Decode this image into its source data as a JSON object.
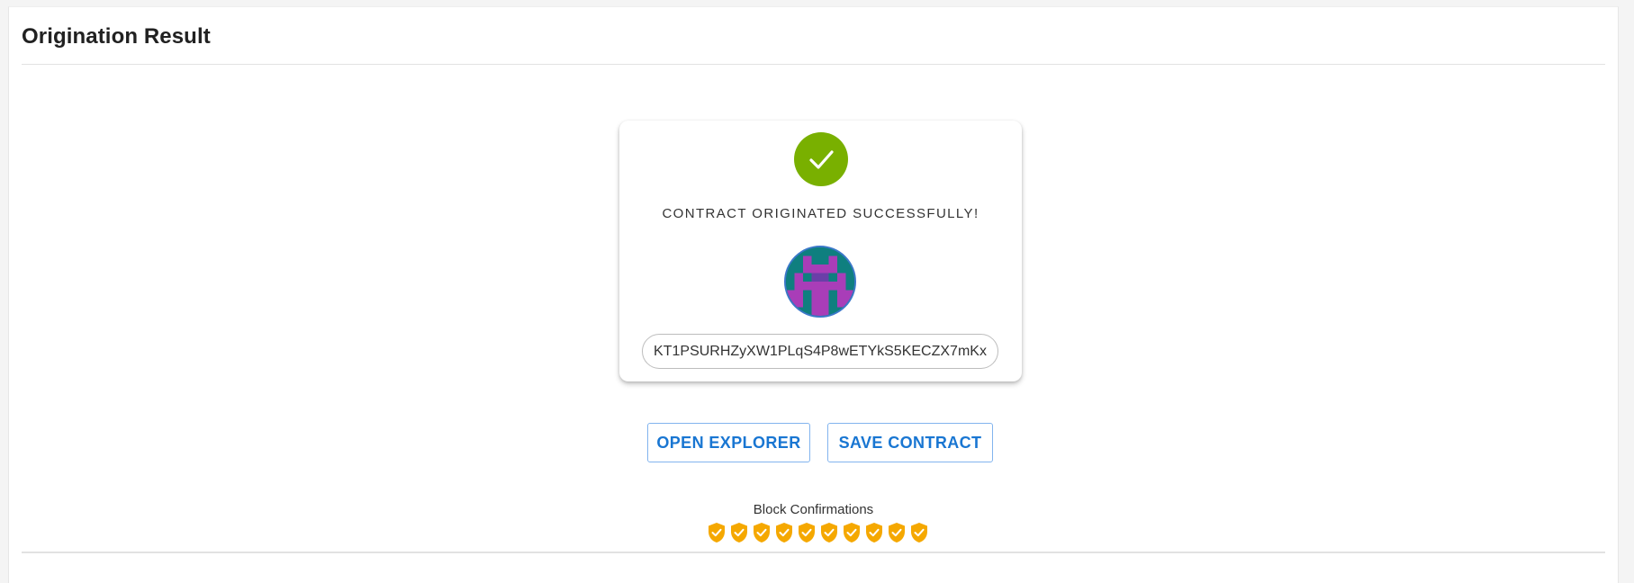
{
  "header": {
    "title": "Origination Result"
  },
  "result_card": {
    "icon": "check-circle-icon",
    "success_message": "CONTRACT ORIGINATED SUCCESSFULLY!",
    "avatar": "contract-identicon",
    "contract_address": "KT1PSURHZyXW1PLqS4P8wETYkS5KECZX7mKx"
  },
  "actions": {
    "open_explorer_label": "OPEN EXPLORER",
    "save_contract_label": "SAVE CONTRACT"
  },
  "confirmations": {
    "label": "Block Confirmations",
    "count": 10,
    "icon": "shield-check-icon"
  },
  "colors": {
    "success": "#79b000",
    "accent": "#1976d2",
    "shield": "#f5a800"
  }
}
